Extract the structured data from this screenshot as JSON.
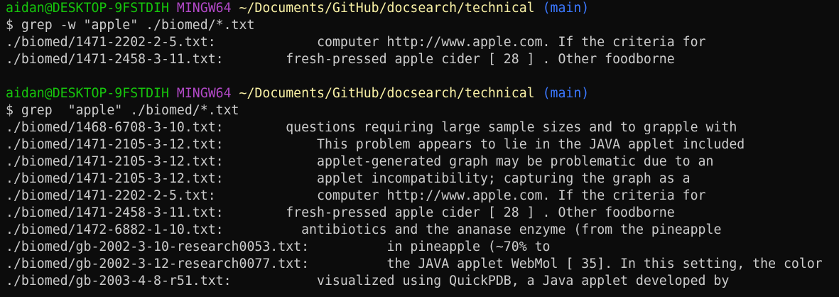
{
  "prompt": {
    "user_host": "aidan@DESKTOP-9FSTDIH",
    "system": "MINGW64",
    "cwd": "~/Documents/GitHub/docsearch/technical",
    "branch": "(main)"
  },
  "blocks": [
    {
      "command": "$ grep -w \"apple\" ./biomed/*.txt",
      "results": [
        {
          "file": "./biomed/1471-2202-2-5.txt:",
          "text": "             computer http://www.apple.com. If the criteria for"
        },
        {
          "file": "./biomed/1471-2458-3-11.txt:",
          "text": "        fresh-pressed apple cider [ 28 ] . Other foodborne"
        }
      ]
    },
    {
      "command": "$ grep  \"apple\" ./biomed/*.txt",
      "results": [
        {
          "file": "./biomed/1468-6708-3-10.txt:",
          "text": "        questions requiring large sample sizes and to grapple with"
        },
        {
          "file": "./biomed/1471-2105-3-12.txt:",
          "text": "            This problem appears to lie in the JAVA applet included"
        },
        {
          "file": "./biomed/1471-2105-3-12.txt:",
          "text": "            applet-generated graph may be problematic due to an"
        },
        {
          "file": "./biomed/1471-2105-3-12.txt:",
          "text": "            applet incompatibility; capturing the graph as a"
        },
        {
          "file": "./biomed/1471-2202-2-5.txt:",
          "text": "             computer http://www.apple.com. If the criteria for"
        },
        {
          "file": "./biomed/1471-2458-3-11.txt:",
          "text": "        fresh-pressed apple cider [ 28 ] . Other foodborne"
        },
        {
          "file": "./biomed/1472-6882-1-10.txt:",
          "text": "          antibiotics and the ananase enzyme (from the pineapple"
        },
        {
          "file": "./biomed/gb-2002-3-10-research0053.txt:",
          "text": "          in pineapple (~70% to"
        },
        {
          "file": "./biomed/gb-2002-3-12-research0077.txt:",
          "text": "          the JAVA applet WebMol [ 35]. In this setting, the color"
        },
        {
          "file": "./biomed/gb-2003-4-8-r51.txt:",
          "text": "           visualized using QuickPDB, a Java applet developed by"
        }
      ]
    }
  ],
  "colors": {
    "background": "#0c0c0c",
    "text": "#cccccc",
    "user_host": "#16c60c",
    "system": "#b148c6",
    "cwd": "#f9f1a5",
    "branch": "#3b78ff"
  }
}
